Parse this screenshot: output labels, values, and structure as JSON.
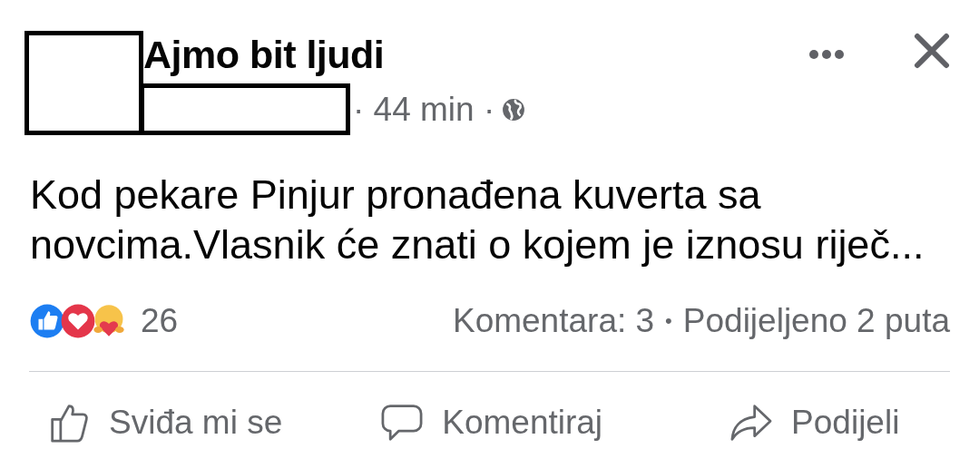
{
  "post": {
    "group": "Ajmo bit ljudi",
    "time": "· 44 min ·",
    "body": "Kod pekare Pinjur pronađena kuverta sa novcima.Vlasnik će znati o kojem je iznosu riječ..."
  },
  "reactions": {
    "count": "26"
  },
  "stats": [
    "Komentara: 3",
    "•",
    "Podijeljeno 2 puta"
  ],
  "actions": [
    {
      "kind": "like",
      "label": "Sviđa mi se"
    },
    {
      "kind": "comment",
      "label": "Komentiraj"
    },
    {
      "kind": "share",
      "label": "Podijeli"
    }
  ]
}
